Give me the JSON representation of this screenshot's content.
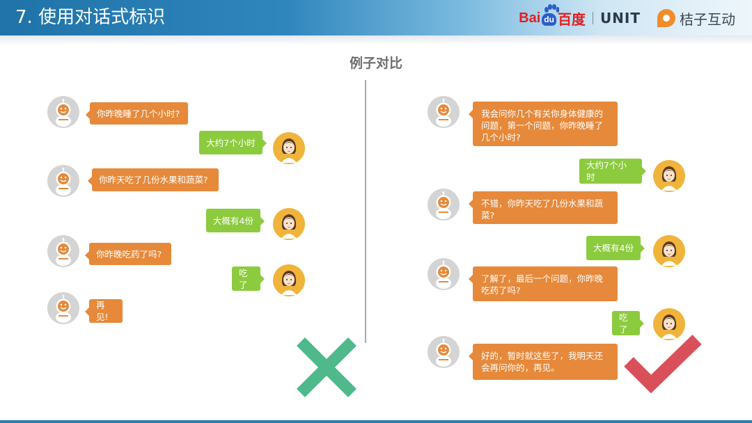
{
  "header": {
    "title": "7. 使用对话式标识"
  },
  "logos": {
    "baidu_prefix": "Bai",
    "baidu_du": "du",
    "baidu_cn": "百度",
    "unit": "UNIT",
    "brand": "桔子互动"
  },
  "section_title": "例子对比",
  "left_conversation": [
    {
      "role": "bot",
      "text": "你昨晚睡了几个小时?"
    },
    {
      "role": "user",
      "text": "大约7个小时"
    },
    {
      "role": "bot",
      "text": "你昨天吃了几份水果和蔬菜?"
    },
    {
      "role": "user",
      "text": "大概有4份"
    },
    {
      "role": "bot",
      "text": "你昨晚吃药了吗?"
    },
    {
      "role": "user",
      "text": "吃了"
    },
    {
      "role": "bot",
      "text": "再见!"
    }
  ],
  "right_conversation": [
    {
      "role": "bot",
      "text": "我会问你几个有关你身体健康的问题，第一个问题，你昨晚睡了几个小时?"
    },
    {
      "role": "user",
      "text": "大约7个小时"
    },
    {
      "role": "bot",
      "text": "不错，你昨天吃了几份水果和蔬菜?"
    },
    {
      "role": "user",
      "text": "大概有4份"
    },
    {
      "role": "bot",
      "text": "了解了，最后一个问题，你昨晚吃药了吗?"
    },
    {
      "role": "user",
      "text": "吃了"
    },
    {
      "role": "bot",
      "text": "好的，暂时就这些了，我明天还会再问你的，再见。"
    }
  ],
  "colors": {
    "bot_bubble": "#e6893a",
    "user_bubble": "#8ccb3e",
    "wrong_mark": "#4fb98c",
    "right_mark": "#d9505a",
    "header": "#2a7eb3"
  },
  "icons": {
    "wrong": "cross-icon",
    "right": "checkmark-icon",
    "bot_avatar": "robot-avatar",
    "user_avatar": "girl-avatar"
  }
}
